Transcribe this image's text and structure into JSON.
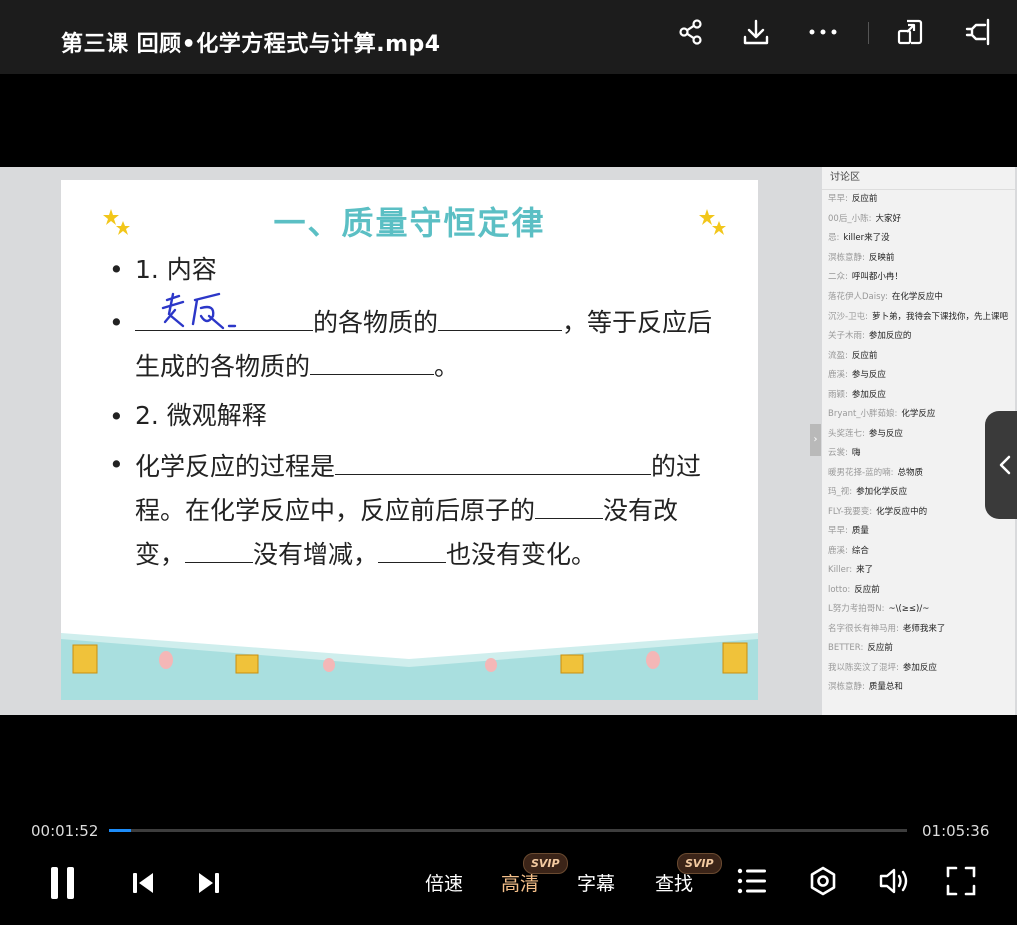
{
  "header": {
    "title": "第三课 回顾•化学方程式与计算.mp4",
    "icons": [
      "share-icon",
      "download-icon",
      "more-icon",
      "picture-in-picture-icon",
      "pin-icon"
    ]
  },
  "slide": {
    "title": "一、质量守恒定律",
    "item1": "1. 内容",
    "line2_mid": "的各物质的",
    "line2_end": "，等于反应后",
    "line3_start": "生成的各物质的",
    "line3_end": "。",
    "item3": "2. 微观解释",
    "line5_start": "化学反应的过程是",
    "line5_end": "的过",
    "line6_start": "程。在化学反应中，反应前后原子的",
    "line6_end": "没有改",
    "line7_start": "变，",
    "line7_mid": "没有增减，",
    "line7_end": "也没有变化。",
    "handwriting": "参反"
  },
  "chat": {
    "header": "讨论区",
    "messages": [
      {
        "user": "早早:",
        "text": "反应前"
      },
      {
        "user": "00后_小陈:",
        "text": "大家好"
      },
      {
        "user": "忌:",
        "text": "killer来了没"
      },
      {
        "user": "溟栋意静:",
        "text": "反映前"
      },
      {
        "user": "二众:",
        "text": "呼叫都小冉！"
      },
      {
        "user": "落花伊人Daisy:",
        "text": "在化学反应中"
      },
      {
        "user": "沉沙-卫屯:",
        "text": "萝卜弟，我待会下课找你，先上课吧"
      },
      {
        "user": "关子木雨:",
        "text": "参加反应的"
      },
      {
        "user": "流盈:",
        "text": "反应前"
      },
      {
        "user": "鹿溪:",
        "text": "参与反应"
      },
      {
        "user": "雨颖:",
        "text": "参加反应"
      },
      {
        "user": "Bryant_小胖茹娘:",
        "text": "化学反应"
      },
      {
        "user": "头奖莲七:",
        "text": "参与反应"
      },
      {
        "user": "云裳:",
        "text": "嗨"
      },
      {
        "user": "暖男花择-蓝的喃:",
        "text": "总物质"
      },
      {
        "user": "玛_视:",
        "text": "参加化学反应"
      },
      {
        "user": "FLY-我要变:",
        "text": "化学反应中的"
      },
      {
        "user": "早早:",
        "text": "质量"
      },
      {
        "user": "鹿溪:",
        "text": "综合"
      },
      {
        "user": "Killer:",
        "text": "来了"
      },
      {
        "user": "lotto:",
        "text": "反应前"
      },
      {
        "user": "L努力考拍哥N:",
        "text": "~\\(≥≤)/~"
      },
      {
        "user": "名字很长有神马用:",
        "text": "老师我来了"
      },
      {
        "user": "BETTER:",
        "text": "反应前"
      },
      {
        "user": "我以陈奕汶了混坪:",
        "text": "参加反应"
      },
      {
        "user": "溟栋意静:",
        "text": "质量总和"
      }
    ]
  },
  "player": {
    "current_time": "00:01:52",
    "total_time": "01:05:36",
    "progress_fraction": 0.028,
    "speed_label": "倍速",
    "quality_label": "高清",
    "subtitle_label": "字幕",
    "search_label": "查找",
    "svip_badge": "SVIP",
    "accent_color": "#1d8cf8",
    "quality_color": "#f5c08a"
  }
}
